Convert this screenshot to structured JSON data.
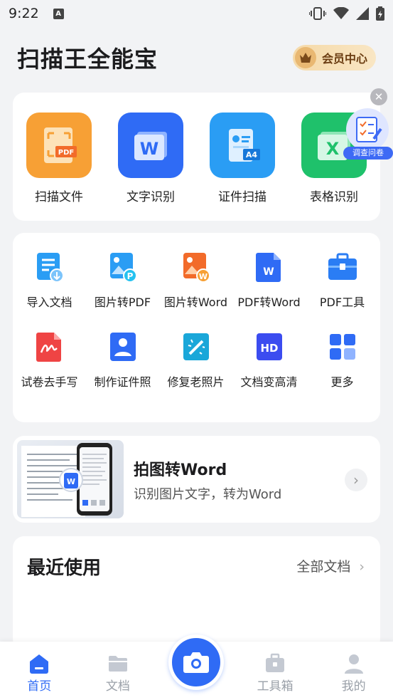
{
  "status": {
    "time": "9:22",
    "notification_letter": "A"
  },
  "header": {
    "title": "扫描王全能宝",
    "vip_label": "会员中心"
  },
  "main_tools": [
    {
      "label": "扫描文件",
      "icon": "scan-pdf-icon",
      "color": "#f7a035",
      "badge": "PDF"
    },
    {
      "label": "文字识别",
      "icon": "word-recognition-icon",
      "color": "#2f6bf5",
      "badge": "W"
    },
    {
      "label": "证件扫描",
      "icon": "id-card-icon",
      "color": "#2a9df4",
      "badge": "A4"
    },
    {
      "label": "表格识别",
      "icon": "excel-icon",
      "color": "#1fc16b",
      "badge": "X"
    }
  ],
  "survey": {
    "label": "调查问卷"
  },
  "grid_tools": [
    {
      "label": "导入文档",
      "icon": "import-doc-icon"
    },
    {
      "label": "图片转PDF",
      "icon": "image-to-pdf-icon",
      "badge": "P"
    },
    {
      "label": "图片转Word",
      "icon": "image-to-word-icon",
      "badge": "W"
    },
    {
      "label": "PDF转Word",
      "icon": "pdf-to-word-icon",
      "badge": "W"
    },
    {
      "label": "PDF工具",
      "icon": "pdf-toolbox-icon"
    },
    {
      "label": "试卷去手写",
      "icon": "remove-handwriting-icon"
    },
    {
      "label": "制作证件照",
      "icon": "id-photo-icon"
    },
    {
      "label": "修复老照片",
      "icon": "restore-photo-icon"
    },
    {
      "label": "文档变高清",
      "icon": "hd-document-icon",
      "badge": "HD"
    },
    {
      "label": "更多",
      "icon": "more-grid-icon"
    }
  ],
  "promo": {
    "title": "拍图转Word",
    "subtitle": "识别图片文字，转为Word",
    "badge": "W"
  },
  "recent": {
    "title": "最近使用",
    "all_docs": "全部文档"
  },
  "nav": [
    {
      "label": "首页",
      "icon": "home-icon"
    },
    {
      "label": "文档",
      "icon": "folder-icon"
    },
    {
      "label": "工具箱",
      "icon": "toolbox-icon"
    },
    {
      "label": "我的",
      "icon": "profile-icon"
    }
  ],
  "colors": {
    "accent": "#2f6bf5",
    "vip_gold": "#f5d9a8"
  }
}
